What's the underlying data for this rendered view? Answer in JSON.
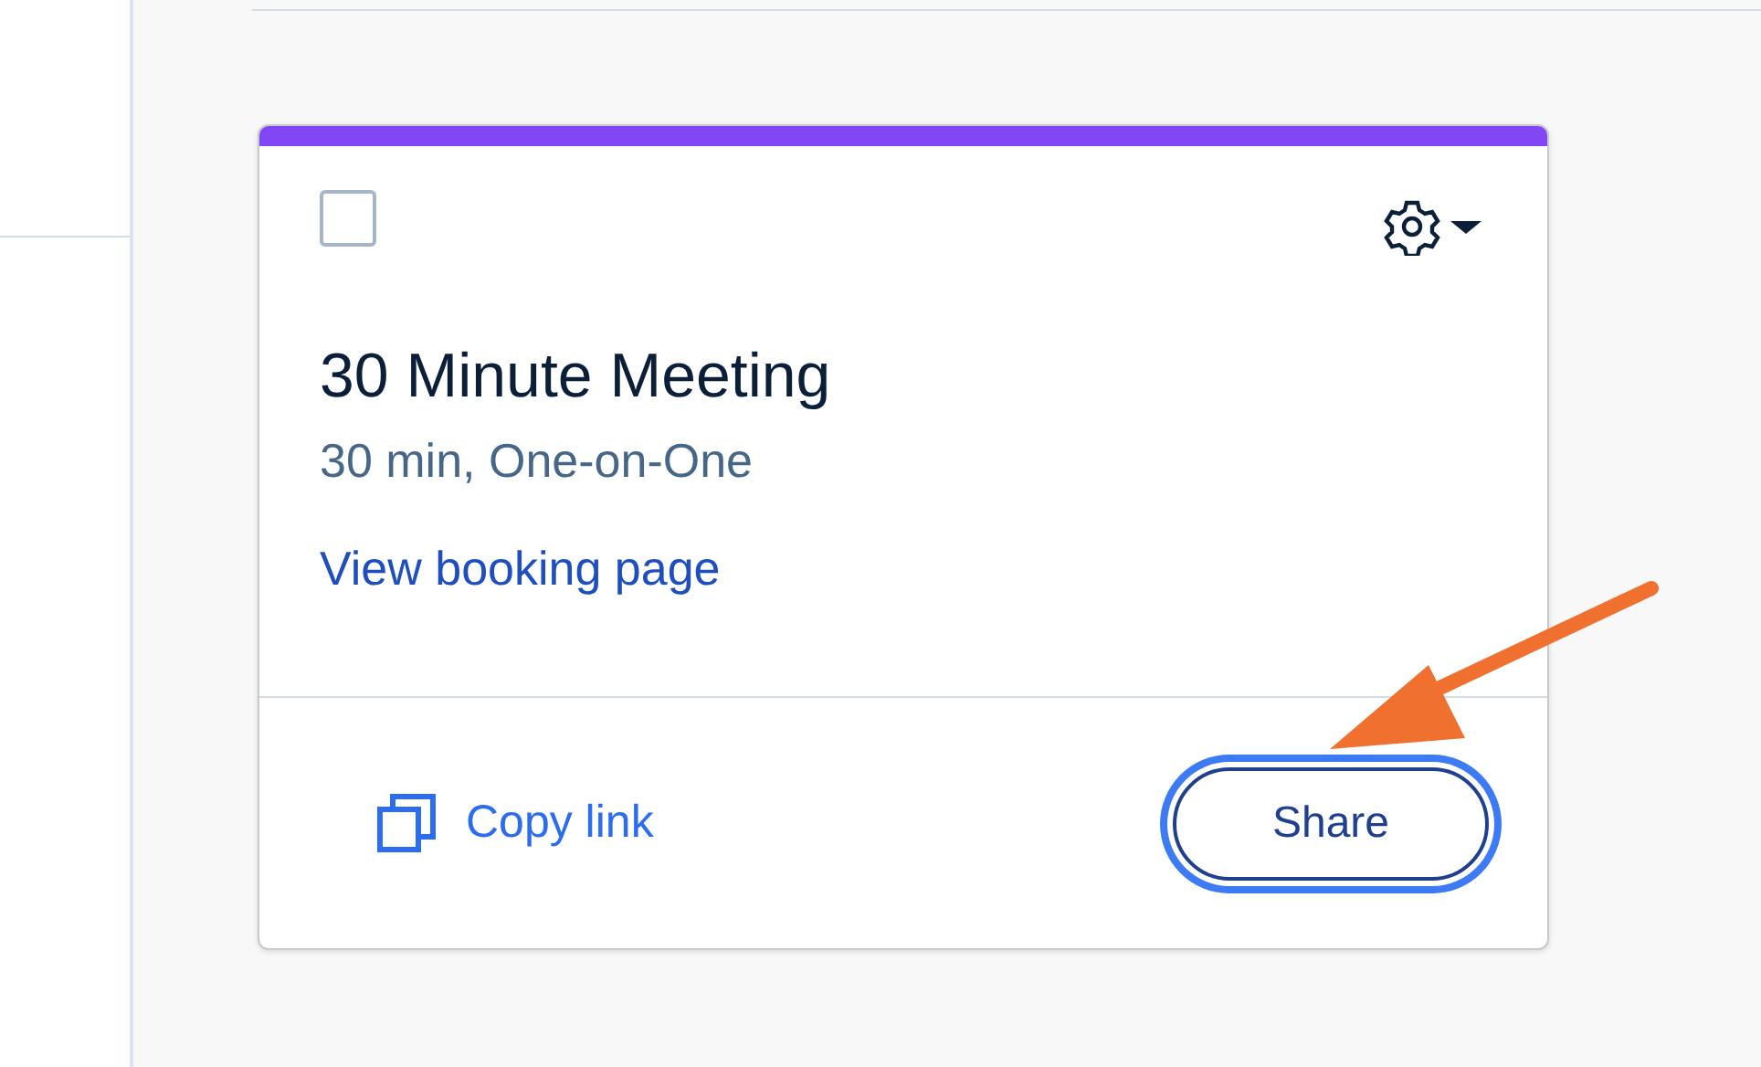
{
  "event_card": {
    "selected": false,
    "title": "30 Minute Meeting",
    "details": "30 min, One-on-One",
    "booking_link": "View booking page",
    "copy_link": "Copy link",
    "share_button": {
      "label": "Share",
      "focused": true
    }
  }
}
